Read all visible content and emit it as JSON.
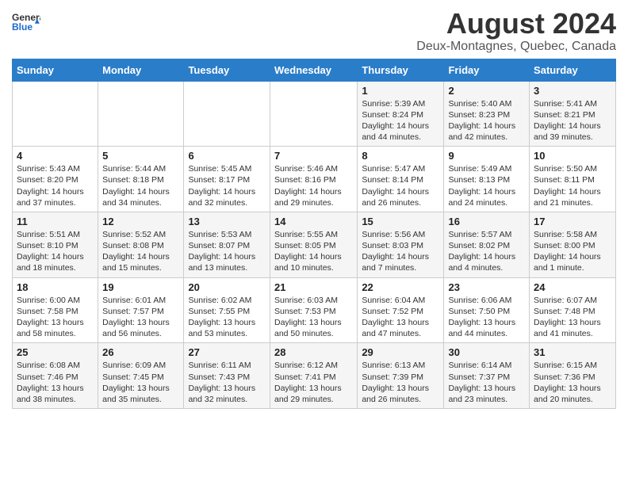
{
  "header": {
    "logo_line1": "General",
    "logo_line2": "Blue",
    "main_title": "August 2024",
    "subtitle": "Deux-Montagnes, Quebec, Canada"
  },
  "calendar": {
    "weekdays": [
      "Sunday",
      "Monday",
      "Tuesday",
      "Wednesday",
      "Thursday",
      "Friday",
      "Saturday"
    ],
    "weeks": [
      [
        {
          "day": "",
          "info": ""
        },
        {
          "day": "",
          "info": ""
        },
        {
          "day": "",
          "info": ""
        },
        {
          "day": "",
          "info": ""
        },
        {
          "day": "1",
          "info": "Sunrise: 5:39 AM\nSunset: 8:24 PM\nDaylight: 14 hours\nand 44 minutes."
        },
        {
          "day": "2",
          "info": "Sunrise: 5:40 AM\nSunset: 8:23 PM\nDaylight: 14 hours\nand 42 minutes."
        },
        {
          "day": "3",
          "info": "Sunrise: 5:41 AM\nSunset: 8:21 PM\nDaylight: 14 hours\nand 39 minutes."
        }
      ],
      [
        {
          "day": "4",
          "info": "Sunrise: 5:43 AM\nSunset: 8:20 PM\nDaylight: 14 hours\nand 37 minutes."
        },
        {
          "day": "5",
          "info": "Sunrise: 5:44 AM\nSunset: 8:18 PM\nDaylight: 14 hours\nand 34 minutes."
        },
        {
          "day": "6",
          "info": "Sunrise: 5:45 AM\nSunset: 8:17 PM\nDaylight: 14 hours\nand 32 minutes."
        },
        {
          "day": "7",
          "info": "Sunrise: 5:46 AM\nSunset: 8:16 PM\nDaylight: 14 hours\nand 29 minutes."
        },
        {
          "day": "8",
          "info": "Sunrise: 5:47 AM\nSunset: 8:14 PM\nDaylight: 14 hours\nand 26 minutes."
        },
        {
          "day": "9",
          "info": "Sunrise: 5:49 AM\nSunset: 8:13 PM\nDaylight: 14 hours\nand 24 minutes."
        },
        {
          "day": "10",
          "info": "Sunrise: 5:50 AM\nSunset: 8:11 PM\nDaylight: 14 hours\nand 21 minutes."
        }
      ],
      [
        {
          "day": "11",
          "info": "Sunrise: 5:51 AM\nSunset: 8:10 PM\nDaylight: 14 hours\nand 18 minutes."
        },
        {
          "day": "12",
          "info": "Sunrise: 5:52 AM\nSunset: 8:08 PM\nDaylight: 14 hours\nand 15 minutes."
        },
        {
          "day": "13",
          "info": "Sunrise: 5:53 AM\nSunset: 8:07 PM\nDaylight: 14 hours\nand 13 minutes."
        },
        {
          "day": "14",
          "info": "Sunrise: 5:55 AM\nSunset: 8:05 PM\nDaylight: 14 hours\nand 10 minutes."
        },
        {
          "day": "15",
          "info": "Sunrise: 5:56 AM\nSunset: 8:03 PM\nDaylight: 14 hours\nand 7 minutes."
        },
        {
          "day": "16",
          "info": "Sunrise: 5:57 AM\nSunset: 8:02 PM\nDaylight: 14 hours\nand 4 minutes."
        },
        {
          "day": "17",
          "info": "Sunrise: 5:58 AM\nSunset: 8:00 PM\nDaylight: 14 hours\nand 1 minute."
        }
      ],
      [
        {
          "day": "18",
          "info": "Sunrise: 6:00 AM\nSunset: 7:58 PM\nDaylight: 13 hours\nand 58 minutes."
        },
        {
          "day": "19",
          "info": "Sunrise: 6:01 AM\nSunset: 7:57 PM\nDaylight: 13 hours\nand 56 minutes."
        },
        {
          "day": "20",
          "info": "Sunrise: 6:02 AM\nSunset: 7:55 PM\nDaylight: 13 hours\nand 53 minutes."
        },
        {
          "day": "21",
          "info": "Sunrise: 6:03 AM\nSunset: 7:53 PM\nDaylight: 13 hours\nand 50 minutes."
        },
        {
          "day": "22",
          "info": "Sunrise: 6:04 AM\nSunset: 7:52 PM\nDaylight: 13 hours\nand 47 minutes."
        },
        {
          "day": "23",
          "info": "Sunrise: 6:06 AM\nSunset: 7:50 PM\nDaylight: 13 hours\nand 44 minutes."
        },
        {
          "day": "24",
          "info": "Sunrise: 6:07 AM\nSunset: 7:48 PM\nDaylight: 13 hours\nand 41 minutes."
        }
      ],
      [
        {
          "day": "25",
          "info": "Sunrise: 6:08 AM\nSunset: 7:46 PM\nDaylight: 13 hours\nand 38 minutes."
        },
        {
          "day": "26",
          "info": "Sunrise: 6:09 AM\nSunset: 7:45 PM\nDaylight: 13 hours\nand 35 minutes."
        },
        {
          "day": "27",
          "info": "Sunrise: 6:11 AM\nSunset: 7:43 PM\nDaylight: 13 hours\nand 32 minutes."
        },
        {
          "day": "28",
          "info": "Sunrise: 6:12 AM\nSunset: 7:41 PM\nDaylight: 13 hours\nand 29 minutes."
        },
        {
          "day": "29",
          "info": "Sunrise: 6:13 AM\nSunset: 7:39 PM\nDaylight: 13 hours\nand 26 minutes."
        },
        {
          "day": "30",
          "info": "Sunrise: 6:14 AM\nSunset: 7:37 PM\nDaylight: 13 hours\nand 23 minutes."
        },
        {
          "day": "31",
          "info": "Sunrise: 6:15 AM\nSunset: 7:36 PM\nDaylight: 13 hours\nand 20 minutes."
        }
      ]
    ]
  }
}
